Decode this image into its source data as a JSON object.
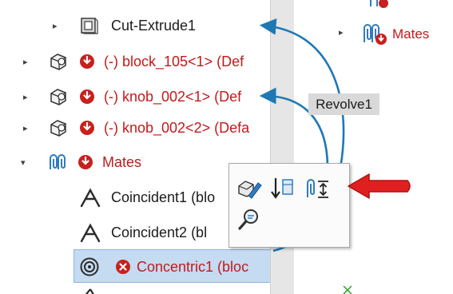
{
  "tree": {
    "items": [
      {
        "label": "Cut-Extrude1",
        "state": "normal",
        "expander": "collapsed"
      },
      {
        "label": "(-) block_105<1> (Def",
        "state": "error",
        "expander": "collapsed"
      },
      {
        "label": "(-) knob_002<1> (Def",
        "state": "error",
        "expander": "collapsed"
      },
      {
        "label": "(-) knob_002<2> (Defa",
        "state": "error",
        "expander": "collapsed"
      },
      {
        "label": "Mates",
        "state": "error",
        "expander": "expanded"
      },
      {
        "label": "Coincident1 (blo",
        "state": "normal"
      },
      {
        "label": "Coincident2 (bl",
        "state": "normal"
      },
      {
        "label": "Concentric1 (bloc",
        "state": "failed",
        "selected": true
      }
    ]
  },
  "right_pane": {
    "mates_label": "Mates"
  },
  "popup": {
    "revolve_label": "Revolve1"
  },
  "icons": {
    "expander_collapsed": "▸",
    "expander_expanded": "▾"
  },
  "colors": {
    "error_text": "#c21a1a",
    "selection_bg": "#c5dbf2",
    "arrow_blue": "#1f78b4",
    "callout_red": "#e02020"
  }
}
